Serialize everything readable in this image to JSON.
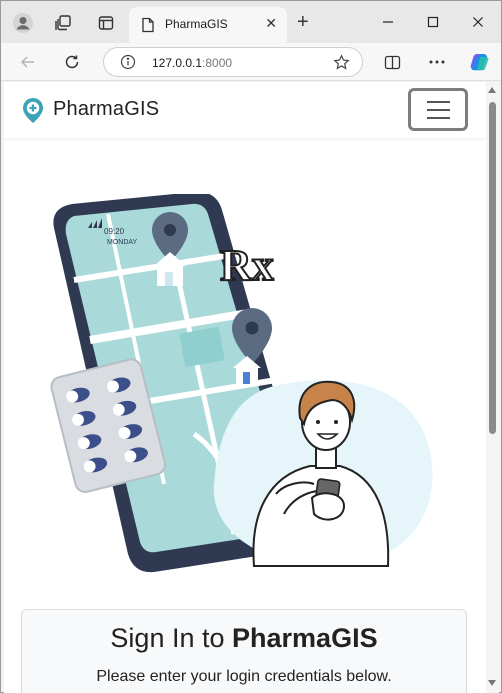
{
  "browser": {
    "tab": {
      "title": "PharmaGIS"
    },
    "address": {
      "host": "127.0.0.1",
      "port": ":8000"
    }
  },
  "site": {
    "brand": "PharmaGIS",
    "hero": {
      "clock_time": "09:20",
      "clock_day": "MONDAY",
      "rx_symbol": "Rx"
    },
    "signin": {
      "title_prefix": "Sign In to ",
      "title_brand": "PharmaGIS",
      "subtitle": "Please enter your login credentials below."
    }
  },
  "colors": {
    "pin": "#5a6b82",
    "map_teal": "#a9d9d9",
    "phone_frame": "#2f3a52",
    "bubble": "#e5f5fa",
    "pill_blue": "#3c4f8a"
  }
}
